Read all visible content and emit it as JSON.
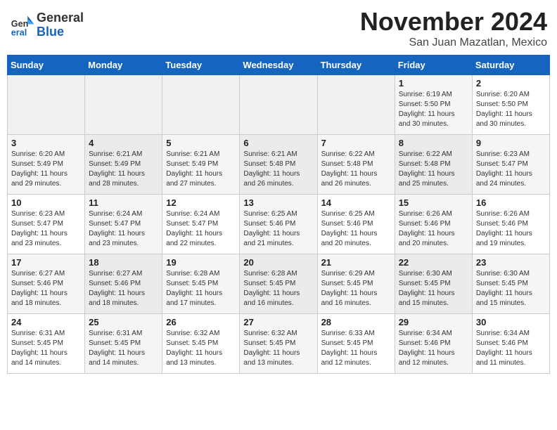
{
  "header": {
    "month_title": "November 2024",
    "location": "San Juan Mazatlan, Mexico",
    "logo_line1": "General",
    "logo_line2": "Blue"
  },
  "days_of_week": [
    "Sunday",
    "Monday",
    "Tuesday",
    "Wednesday",
    "Thursday",
    "Friday",
    "Saturday"
  ],
  "weeks": [
    [
      {
        "num": "",
        "info": "",
        "empty": true
      },
      {
        "num": "",
        "info": "",
        "empty": true
      },
      {
        "num": "",
        "info": "",
        "empty": true
      },
      {
        "num": "",
        "info": "",
        "empty": true
      },
      {
        "num": "",
        "info": "",
        "empty": true
      },
      {
        "num": "1",
        "info": "Sunrise: 6:19 AM\nSunset: 5:50 PM\nDaylight: 11 hours and 30 minutes."
      },
      {
        "num": "2",
        "info": "Sunrise: 6:20 AM\nSunset: 5:50 PM\nDaylight: 11 hours and 30 minutes."
      }
    ],
    [
      {
        "num": "3",
        "info": "Sunrise: 6:20 AM\nSunset: 5:49 PM\nDaylight: 11 hours and 29 minutes."
      },
      {
        "num": "4",
        "info": "Sunrise: 6:21 AM\nSunset: 5:49 PM\nDaylight: 11 hours and 28 minutes."
      },
      {
        "num": "5",
        "info": "Sunrise: 6:21 AM\nSunset: 5:49 PM\nDaylight: 11 hours and 27 minutes."
      },
      {
        "num": "6",
        "info": "Sunrise: 6:21 AM\nSunset: 5:48 PM\nDaylight: 11 hours and 26 minutes."
      },
      {
        "num": "7",
        "info": "Sunrise: 6:22 AM\nSunset: 5:48 PM\nDaylight: 11 hours and 26 minutes."
      },
      {
        "num": "8",
        "info": "Sunrise: 6:22 AM\nSunset: 5:48 PM\nDaylight: 11 hours and 25 minutes."
      },
      {
        "num": "9",
        "info": "Sunrise: 6:23 AM\nSunset: 5:47 PM\nDaylight: 11 hours and 24 minutes."
      }
    ],
    [
      {
        "num": "10",
        "info": "Sunrise: 6:23 AM\nSunset: 5:47 PM\nDaylight: 11 hours and 23 minutes."
      },
      {
        "num": "11",
        "info": "Sunrise: 6:24 AM\nSunset: 5:47 PM\nDaylight: 11 hours and 23 minutes."
      },
      {
        "num": "12",
        "info": "Sunrise: 6:24 AM\nSunset: 5:47 PM\nDaylight: 11 hours and 22 minutes."
      },
      {
        "num": "13",
        "info": "Sunrise: 6:25 AM\nSunset: 5:46 PM\nDaylight: 11 hours and 21 minutes."
      },
      {
        "num": "14",
        "info": "Sunrise: 6:25 AM\nSunset: 5:46 PM\nDaylight: 11 hours and 20 minutes."
      },
      {
        "num": "15",
        "info": "Sunrise: 6:26 AM\nSunset: 5:46 PM\nDaylight: 11 hours and 20 minutes."
      },
      {
        "num": "16",
        "info": "Sunrise: 6:26 AM\nSunset: 5:46 PM\nDaylight: 11 hours and 19 minutes."
      }
    ],
    [
      {
        "num": "17",
        "info": "Sunrise: 6:27 AM\nSunset: 5:46 PM\nDaylight: 11 hours and 18 minutes."
      },
      {
        "num": "18",
        "info": "Sunrise: 6:27 AM\nSunset: 5:46 PM\nDaylight: 11 hours and 18 minutes."
      },
      {
        "num": "19",
        "info": "Sunrise: 6:28 AM\nSunset: 5:45 PM\nDaylight: 11 hours and 17 minutes."
      },
      {
        "num": "20",
        "info": "Sunrise: 6:28 AM\nSunset: 5:45 PM\nDaylight: 11 hours and 16 minutes."
      },
      {
        "num": "21",
        "info": "Sunrise: 6:29 AM\nSunset: 5:45 PM\nDaylight: 11 hours and 16 minutes."
      },
      {
        "num": "22",
        "info": "Sunrise: 6:30 AM\nSunset: 5:45 PM\nDaylight: 11 hours and 15 minutes."
      },
      {
        "num": "23",
        "info": "Sunrise: 6:30 AM\nSunset: 5:45 PM\nDaylight: 11 hours and 15 minutes."
      }
    ],
    [
      {
        "num": "24",
        "info": "Sunrise: 6:31 AM\nSunset: 5:45 PM\nDaylight: 11 hours and 14 minutes."
      },
      {
        "num": "25",
        "info": "Sunrise: 6:31 AM\nSunset: 5:45 PM\nDaylight: 11 hours and 14 minutes."
      },
      {
        "num": "26",
        "info": "Sunrise: 6:32 AM\nSunset: 5:45 PM\nDaylight: 11 hours and 13 minutes."
      },
      {
        "num": "27",
        "info": "Sunrise: 6:32 AM\nSunset: 5:45 PM\nDaylight: 11 hours and 13 minutes."
      },
      {
        "num": "28",
        "info": "Sunrise: 6:33 AM\nSunset: 5:45 PM\nDaylight: 11 hours and 12 minutes."
      },
      {
        "num": "29",
        "info": "Sunrise: 6:34 AM\nSunset: 5:46 PM\nDaylight: 11 hours and 12 minutes."
      },
      {
        "num": "30",
        "info": "Sunrise: 6:34 AM\nSunset: 5:46 PM\nDaylight: 11 hours and 11 minutes."
      }
    ]
  ]
}
